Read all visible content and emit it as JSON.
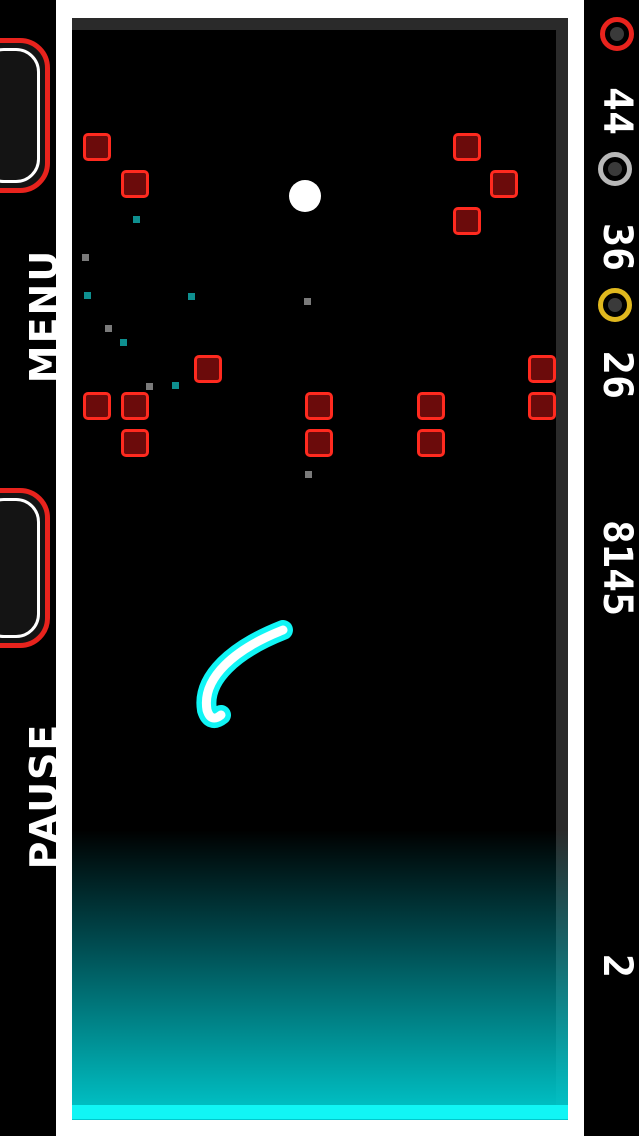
{
  "buttons": {
    "menu_label": "MENU",
    "pause_label": "PAUSE"
  },
  "hud": {
    "score": "8145",
    "level": "2",
    "red_count": "44",
    "silver_count": "36",
    "gold_count": "26"
  },
  "colors": {
    "brick_fill": "#6b0b0b",
    "brick_border": "#ff2a1f",
    "paddle": "#11f5f5",
    "ring_red": "#e8231d",
    "ring_silver": "#b8b8b8",
    "ring_gold": "#e0b81e"
  }
}
